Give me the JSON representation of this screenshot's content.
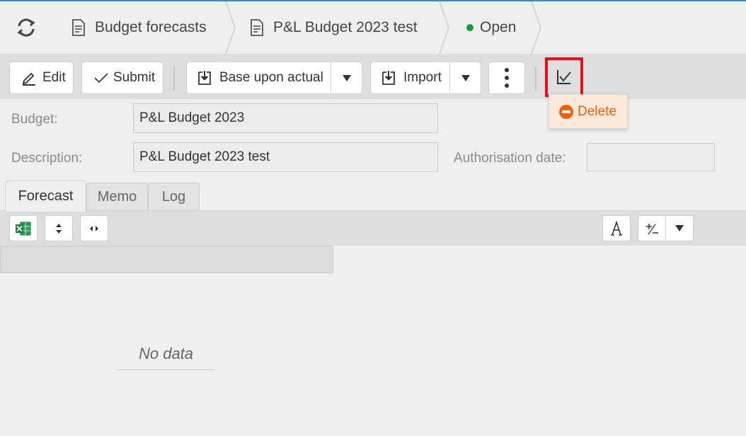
{
  "breadcrumb": {
    "items": [
      {
        "label": "Budget forecasts"
      },
      {
        "label": "P&L Budget 2023 test"
      }
    ],
    "status_label": "Open",
    "status_color": "#1a9a3a"
  },
  "toolbar": {
    "edit_label": "Edit",
    "submit_label": "Submit",
    "base_upon_actual_label": "Base upon actual",
    "import_label": "Import"
  },
  "dropdown": {
    "delete_label": "Delete",
    "accent_color": "#f05f0c"
  },
  "form": {
    "budget_label": "Budget:",
    "budget_value": "P&L Budget 2023",
    "description_label": "Description:",
    "description_value": "P&L Budget 2023 test",
    "authorisation_label": "Authorisation date:",
    "authorisation_value": ""
  },
  "tabs": [
    {
      "label": "Forecast",
      "active": true
    },
    {
      "label": "Memo",
      "active": false
    },
    {
      "label": "Log",
      "active": false
    }
  ],
  "grid": {
    "empty_text": "No data"
  },
  "highlight_color": "#e8101a"
}
